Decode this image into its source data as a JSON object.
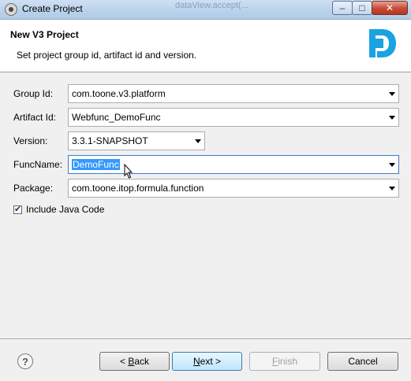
{
  "window": {
    "title": "Create Project",
    "background_text": "dataView.accept(..."
  },
  "banner": {
    "title": "New V3 Project",
    "description": "Set project group id, artifact id and version."
  },
  "form": {
    "group_id": {
      "label": "Group Id:",
      "value": "com.toone.v3.platform"
    },
    "artifact_id": {
      "label": "Artifact Id:",
      "value": "Webfunc_DemoFunc"
    },
    "version": {
      "label": "Version:",
      "value": "3.3.1-SNAPSHOT"
    },
    "func_name": {
      "label": "FuncName:",
      "value": "DemoFunc"
    },
    "package": {
      "label": "Package:",
      "value": "com.toone.itop.formula.function"
    },
    "include_java": {
      "label": "Include Java Code",
      "checked": true
    }
  },
  "buttons": {
    "help": "?",
    "back_prefix": "< ",
    "back_mnemonic": "B",
    "back_rest": "ack",
    "next_mnemonic": "N",
    "next_rest": "ext >",
    "finish_mnemonic": "F",
    "finish_rest": "inish",
    "cancel": "Cancel"
  },
  "colors": {
    "accent": "#3399ff",
    "logo": "#1aa3e0"
  }
}
